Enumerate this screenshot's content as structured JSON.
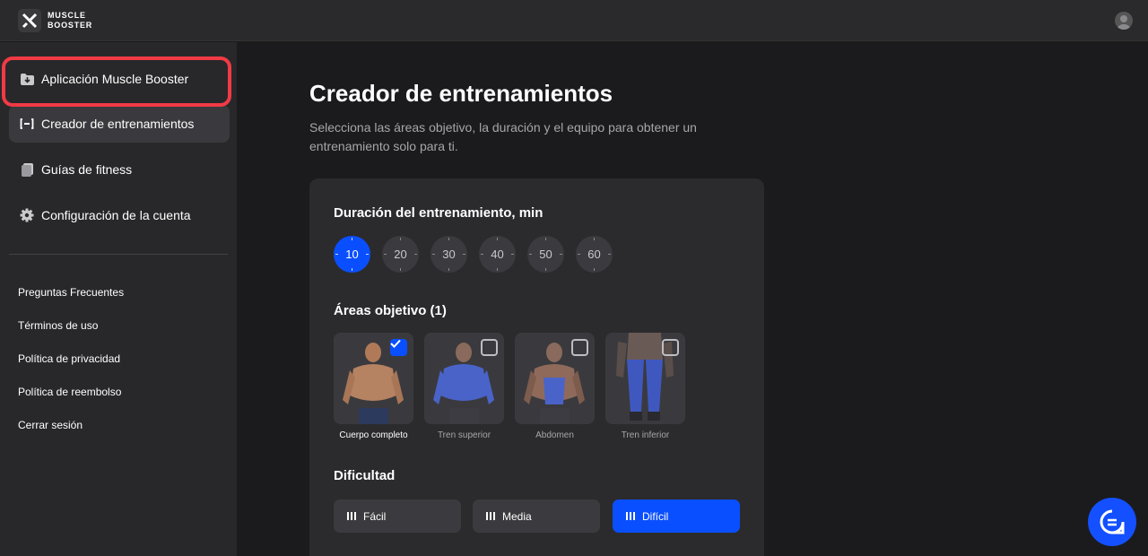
{
  "brand": {
    "line1": "MUSCLE",
    "line2": "BOOSTER"
  },
  "sidebar": {
    "items": [
      {
        "label": "Aplicación Muscle Booster",
        "icon": "download-folder-icon"
      },
      {
        "label": "Creador de entrenamientos",
        "icon": "dumbbell-icon"
      },
      {
        "label": "Guías de fitness",
        "icon": "book-icon"
      },
      {
        "label": "Configuración de la cuenta",
        "icon": "gear-icon"
      }
    ],
    "links": [
      "Preguntas Frecuentes",
      "Términos de uso",
      "Política de privacidad",
      "Política de reembolso",
      "Cerrar sesión"
    ]
  },
  "main": {
    "title": "Creador de entrenamientos",
    "subtitle": "Selecciona las áreas objetivo, la duración y el equipo para obtener un entrenamiento solo para ti."
  },
  "duration": {
    "heading": "Duración del entrenamiento, min",
    "options": [
      "10",
      "20",
      "30",
      "40",
      "50",
      "60"
    ],
    "selected": "10"
  },
  "areas": {
    "heading": "Áreas objetivo (1)",
    "options": [
      {
        "label": "Cuerpo completo",
        "checked": true
      },
      {
        "label": "Tren superior",
        "checked": false
      },
      {
        "label": "Abdomen",
        "checked": false
      },
      {
        "label": "Tren inferior",
        "checked": false
      }
    ]
  },
  "difficulty": {
    "heading": "Dificultad",
    "options": [
      "Fácil",
      "Media",
      "Difícil"
    ],
    "selected": "Difícil"
  },
  "colors": {
    "accent": "#0a4fff",
    "highlight": "#f23a45",
    "sidebar": "#28282a",
    "card": "#2b2b2e"
  }
}
